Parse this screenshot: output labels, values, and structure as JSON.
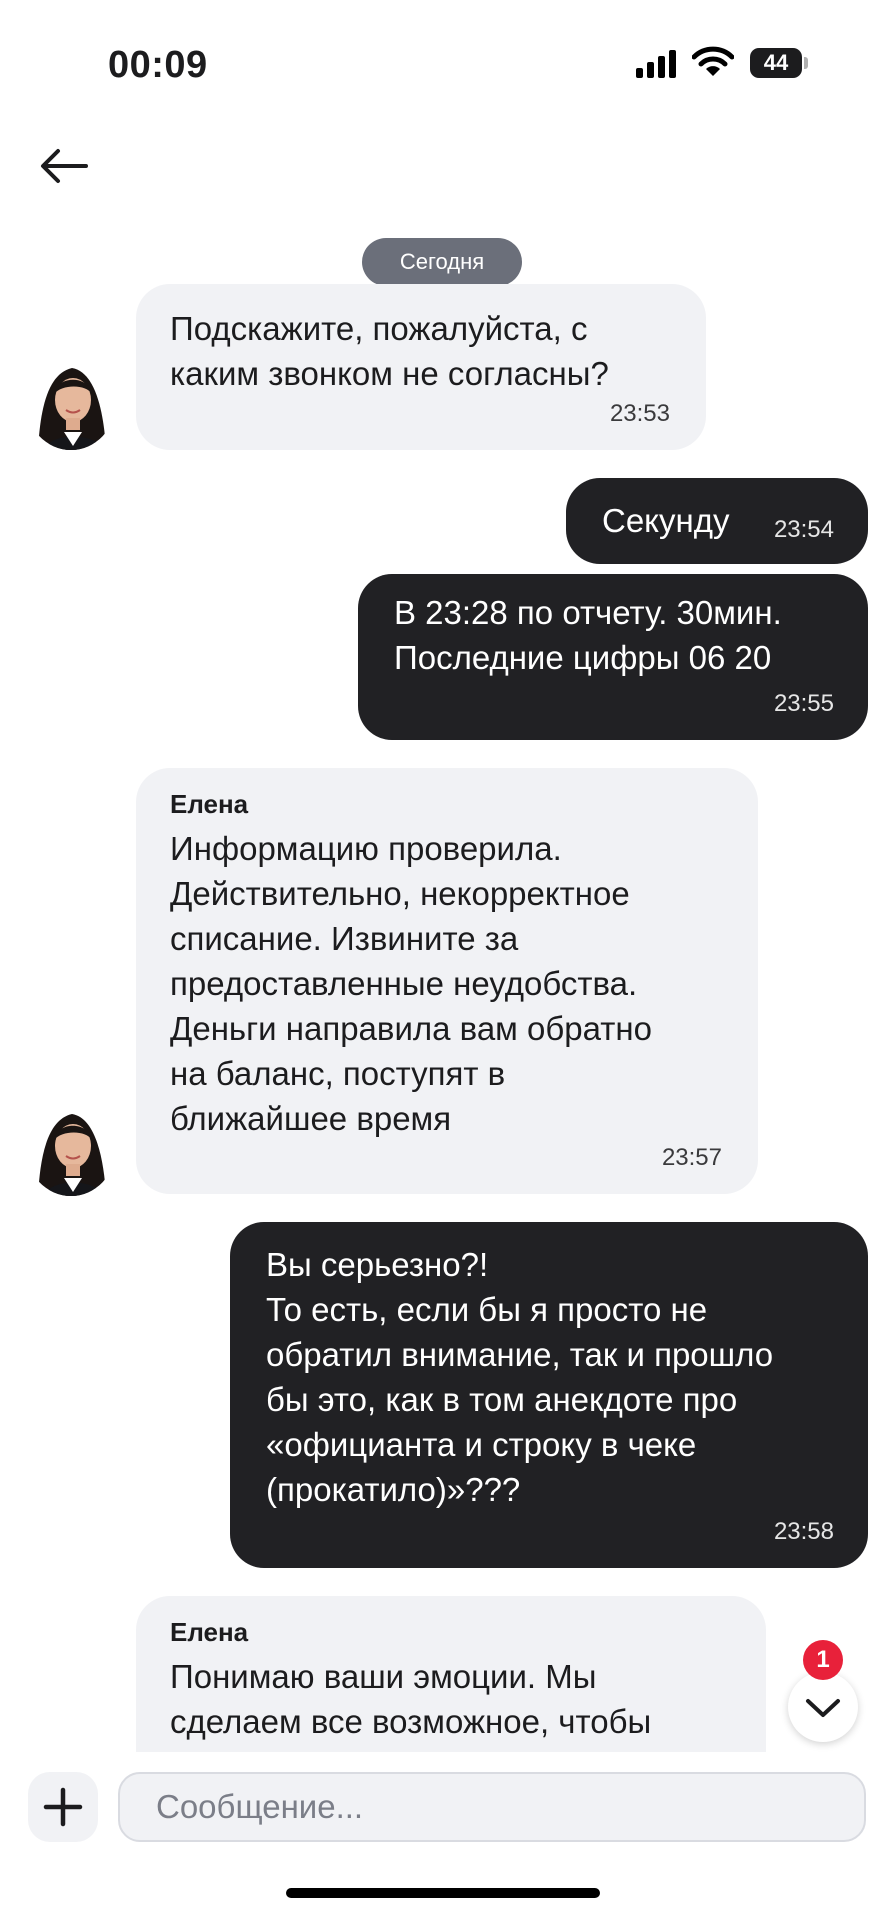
{
  "status_bar": {
    "time": "00:09",
    "battery": "44"
  },
  "chat": {
    "date_label": "Сегодня",
    "messages": [
      {
        "direction": "in",
        "sender": "",
        "text": "Подскажите, пожалуйста, с\nкаким звонком не согласны?",
        "time": "23:53"
      },
      {
        "direction": "out",
        "text": "Секунду",
        "time": "23:54"
      },
      {
        "direction": "out",
        "text": "В 23:28 по отчету. 30мин.\nПоследние цифры 06 20",
        "time": "23:55"
      },
      {
        "direction": "in",
        "sender": "Елена",
        "text": "Информацию проверила.\nДействительно, некорректное\nсписание. Извините за\nпредоставленные неудобства.\nДеньги направила вам обратно\nна баланс, поступят в\nближайшее время",
        "time": "23:57"
      },
      {
        "direction": "out",
        "text": "Вы серьезно?!\nТо есть, если бы я просто не\nобратил внимание, так и прошло\nбы это, как в том анекдоте про\n«официанта и строку в чеке\n(прокатило)»???",
        "time": "23:58"
      },
      {
        "direction": "in",
        "sender": "Елена",
        "text": "Понимаю ваши эмоции. Мы\nсделаем все возможное, чтобы"
      }
    ]
  },
  "scroll_down": {
    "unread_count": "1"
  },
  "composer": {
    "placeholder": "Сообщение..."
  },
  "colors": {
    "incoming_bubble": "#f1f2f5",
    "outgoing_bubble": "#212124",
    "badge": "#e8213a"
  }
}
